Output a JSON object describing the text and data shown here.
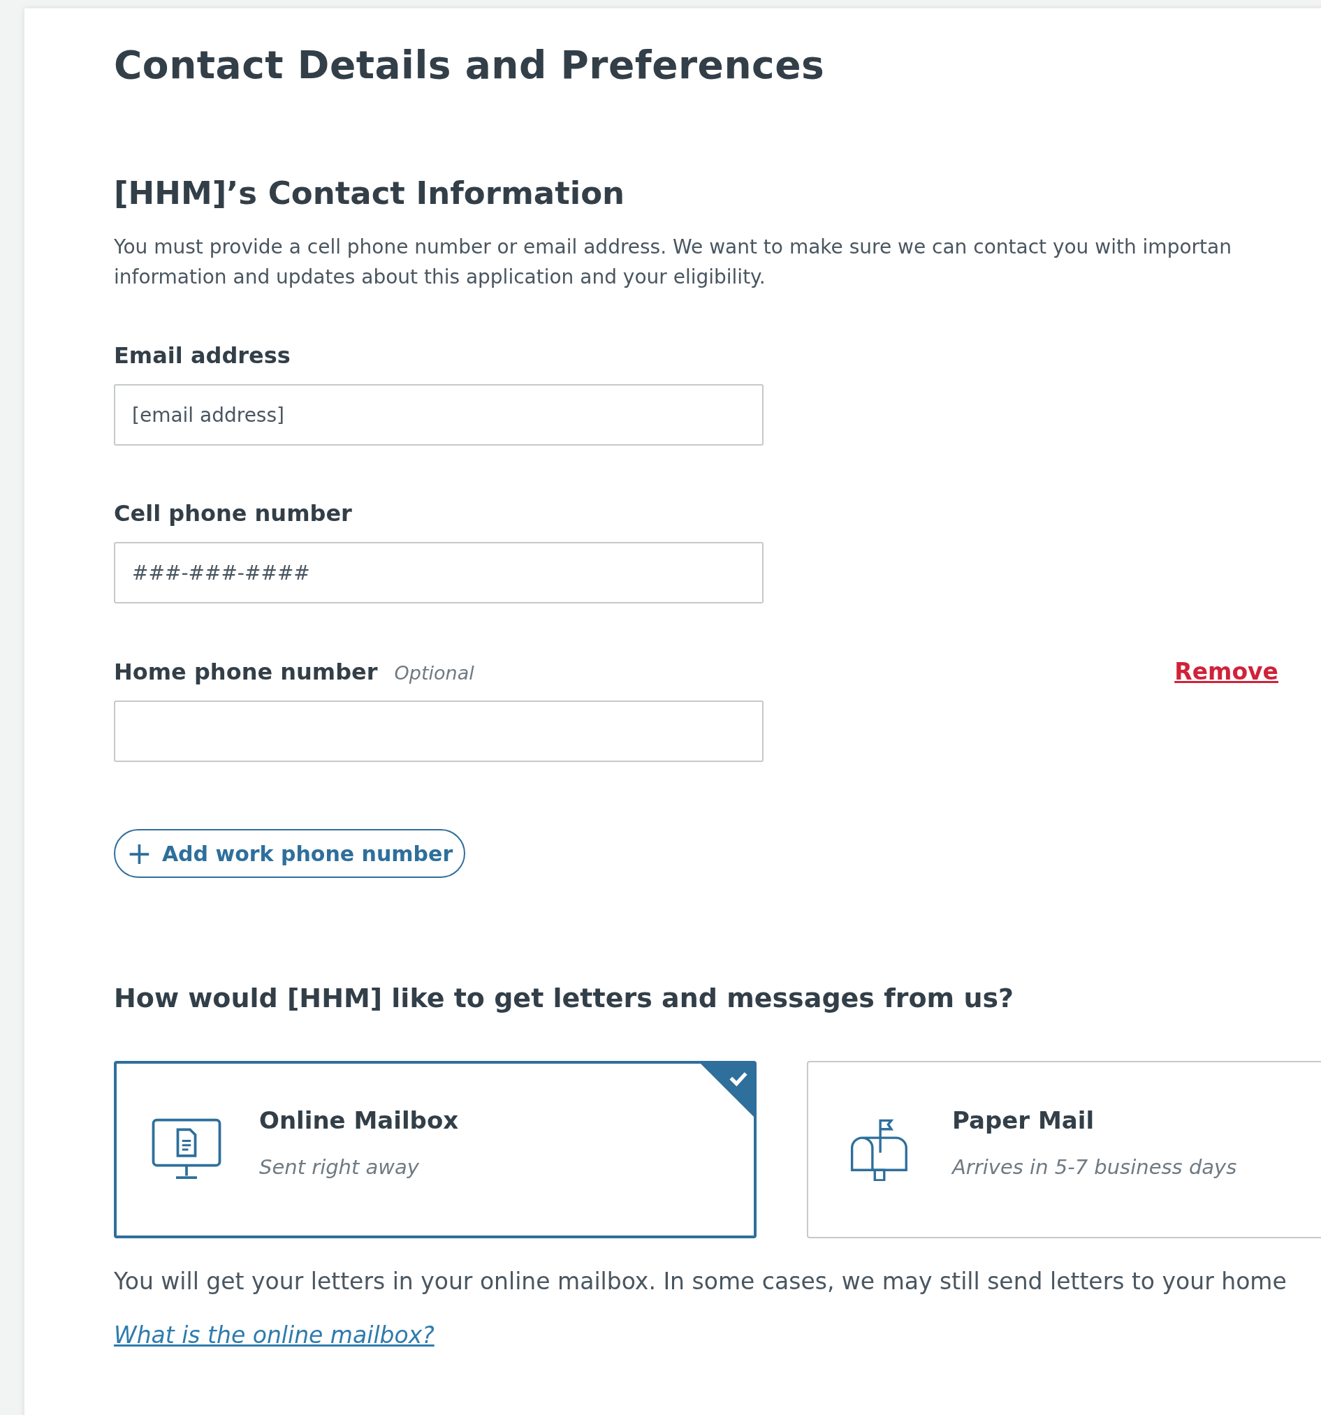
{
  "title": "Contact Details and Preferences",
  "contact": {
    "heading": "[HHM]’s Contact Information",
    "intro_lines": [
      "You must provide a cell phone number or email address. We want to make sure we can contact you with importan",
      "information and updates about this application and your eligibility."
    ],
    "fields": [
      {
        "label": "Email address",
        "placeholder": "[email address]"
      },
      {
        "label": "Cell phone number",
        "placeholder": "###-###-####"
      },
      {
        "label": "Home phone number",
        "optional": "Optional",
        "action": "Remove"
      }
    ],
    "add_button": {
      "icon": "+",
      "label": "Add work phone number"
    }
  },
  "delivery": {
    "question": "How would [HHM] like to get letters and messages from us?",
    "options": [
      {
        "kind": "screen",
        "title": "Online Mailbox",
        "subtitle": "Sent right away",
        "selected": true
      },
      {
        "kind": "mailbox",
        "title": "Paper Mail",
        "subtitle": "Arrives in 5-7 business days",
        "selected": false
      }
    ],
    "note": "You will get your letters in your online mailbox. In some cases, we may still send letters to your home",
    "link": "What is the online mailbox?"
  }
}
